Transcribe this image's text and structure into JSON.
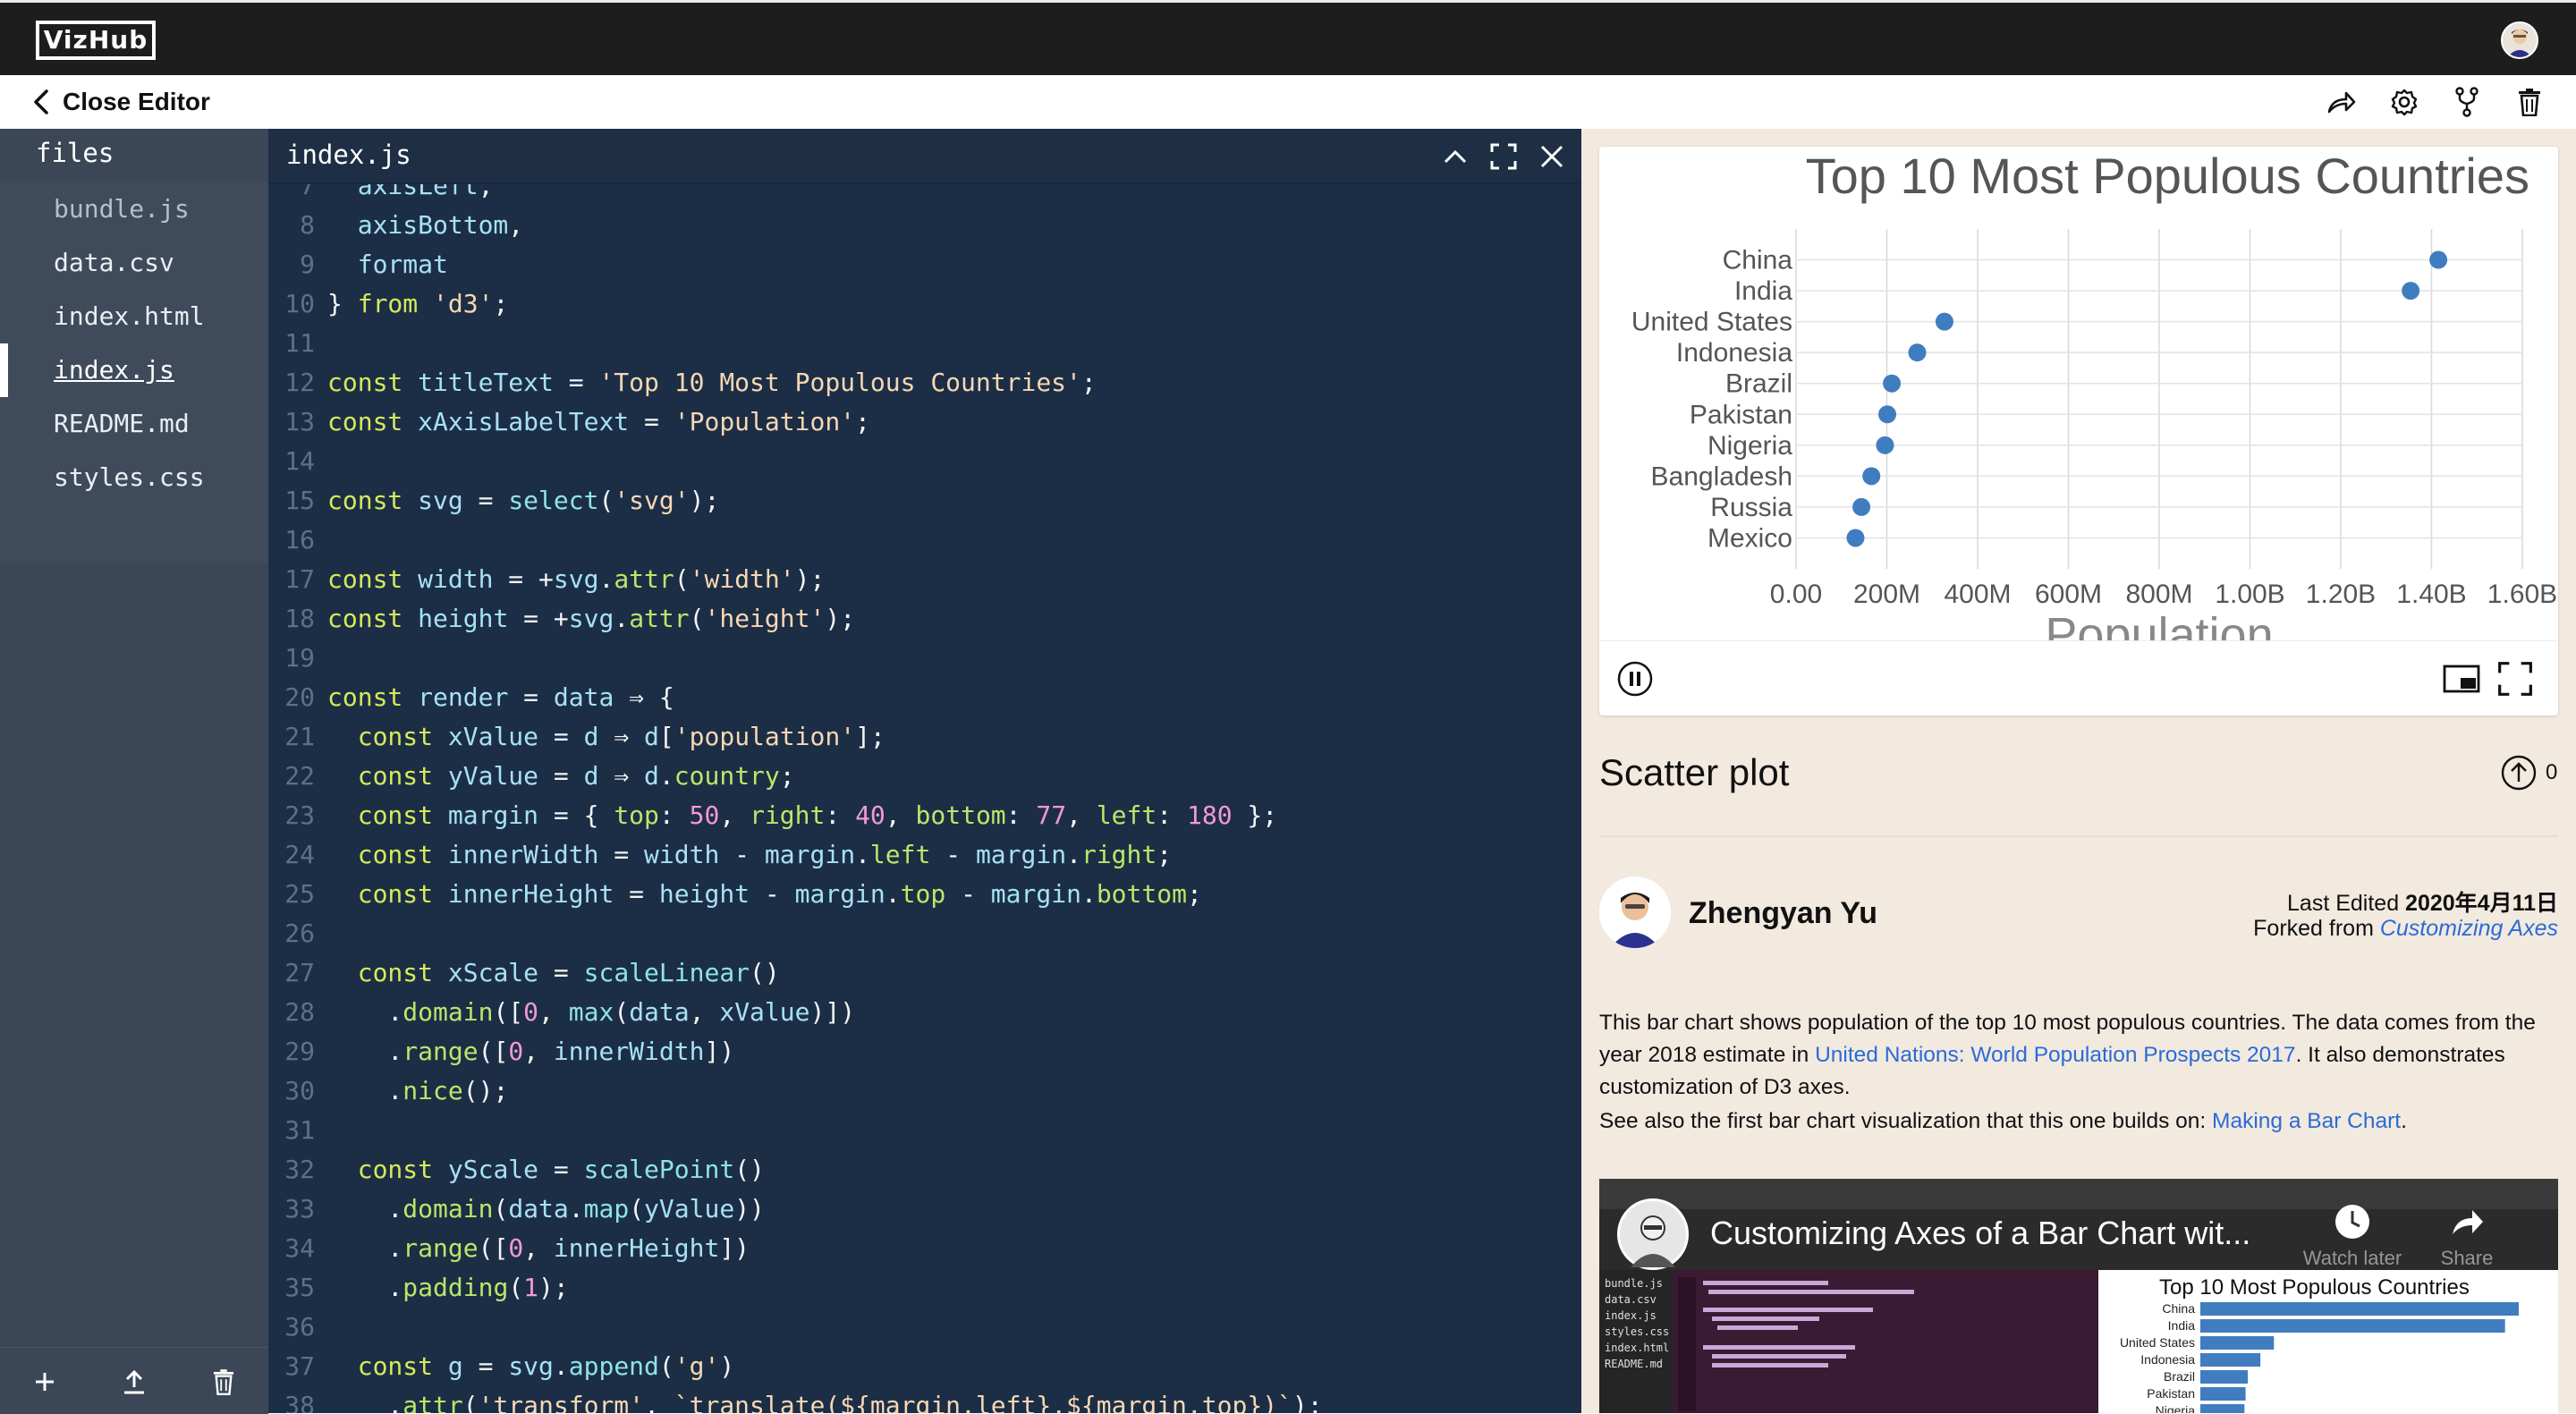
{
  "topbar": {
    "logo_text": "VizHub"
  },
  "header": {
    "close_label": "Close Editor"
  },
  "sidebar": {
    "title": "files",
    "files": [
      {
        "name": "bundle.js",
        "state": "muted"
      },
      {
        "name": "data.csv",
        "state": "normal"
      },
      {
        "name": "index.html",
        "state": "normal"
      },
      {
        "name": "index.js",
        "state": "active"
      },
      {
        "name": "README.md",
        "state": "normal"
      },
      {
        "name": "styles.css",
        "state": "normal"
      }
    ]
  },
  "editor": {
    "tab_name": "index.js",
    "lines": [
      {
        "n": "7",
        "t": [
          [
            "  ",
            "op"
          ],
          [
            "axisLeft",
            "id"
          ],
          [
            ",",
            "op"
          ]
        ]
      },
      {
        "n": "8",
        "t": [
          [
            "  ",
            "op"
          ],
          [
            "axisBottom",
            "id"
          ],
          [
            ",",
            "op"
          ]
        ]
      },
      {
        "n": "9",
        "t": [
          [
            "  ",
            "op"
          ],
          [
            "format",
            "id"
          ]
        ]
      },
      {
        "n": "10",
        "t": [
          [
            "} ",
            "op"
          ],
          [
            "from",
            "kw"
          ],
          [
            " ",
            "op"
          ],
          [
            "'d3'",
            "str"
          ],
          [
            ";",
            "op"
          ]
        ]
      },
      {
        "n": "11",
        "t": []
      },
      {
        "n": "12",
        "t": [
          [
            "const",
            "kw"
          ],
          [
            " ",
            "op"
          ],
          [
            "titleText",
            "id"
          ],
          [
            " = ",
            "op"
          ],
          [
            "'Top 10 Most Populous Countries'",
            "str"
          ],
          [
            ";",
            "op"
          ]
        ]
      },
      {
        "n": "13",
        "t": [
          [
            "const",
            "kw"
          ],
          [
            " ",
            "op"
          ],
          [
            "xAxisLabelText",
            "id"
          ],
          [
            " = ",
            "op"
          ],
          [
            "'Population'",
            "str"
          ],
          [
            ";",
            "op"
          ]
        ]
      },
      {
        "n": "14",
        "t": []
      },
      {
        "n": "15",
        "t": [
          [
            "const",
            "kw"
          ],
          [
            " ",
            "op"
          ],
          [
            "svg",
            "id"
          ],
          [
            " = ",
            "op"
          ],
          [
            "select",
            "fn"
          ],
          [
            "(",
            "op"
          ],
          [
            "'svg'",
            "str"
          ],
          [
            ");",
            "op"
          ]
        ]
      },
      {
        "n": "16",
        "t": []
      },
      {
        "n": "17",
        "t": [
          [
            "const",
            "kw"
          ],
          [
            " ",
            "op"
          ],
          [
            "width",
            "id"
          ],
          [
            " = +",
            "op"
          ],
          [
            "svg",
            "id"
          ],
          [
            ".",
            "op"
          ],
          [
            "attr",
            "prop"
          ],
          [
            "(",
            "op"
          ],
          [
            "'width'",
            "str"
          ],
          [
            ");",
            "op"
          ]
        ]
      },
      {
        "n": "18",
        "t": [
          [
            "const",
            "kw"
          ],
          [
            " ",
            "op"
          ],
          [
            "height",
            "id"
          ],
          [
            " = +",
            "op"
          ],
          [
            "svg",
            "id"
          ],
          [
            ".",
            "op"
          ],
          [
            "attr",
            "prop"
          ],
          [
            "(",
            "op"
          ],
          [
            "'height'",
            "str"
          ],
          [
            ");",
            "op"
          ]
        ]
      },
      {
        "n": "19",
        "t": []
      },
      {
        "n": "20",
        "t": [
          [
            "const",
            "kw"
          ],
          [
            " ",
            "op"
          ],
          [
            "render",
            "id"
          ],
          [
            " = ",
            "op"
          ],
          [
            "data",
            "id"
          ],
          [
            " ⇒ {",
            "op"
          ]
        ]
      },
      {
        "n": "21",
        "t": [
          [
            "  ",
            "op"
          ],
          [
            "const",
            "kw"
          ],
          [
            " ",
            "op"
          ],
          [
            "xValue",
            "id"
          ],
          [
            " = ",
            "op"
          ],
          [
            "d",
            "id"
          ],
          [
            " ⇒ ",
            "op"
          ],
          [
            "d",
            "id"
          ],
          [
            "[",
            "op"
          ],
          [
            "'population'",
            "str"
          ],
          [
            "];",
            "op"
          ]
        ]
      },
      {
        "n": "22",
        "t": [
          [
            "  ",
            "op"
          ],
          [
            "const",
            "kw"
          ],
          [
            " ",
            "op"
          ],
          [
            "yValue",
            "id"
          ],
          [
            " = ",
            "op"
          ],
          [
            "d",
            "id"
          ],
          [
            " ⇒ ",
            "op"
          ],
          [
            "d",
            "id"
          ],
          [
            ".",
            "op"
          ],
          [
            "country",
            "prop"
          ],
          [
            ";",
            "op"
          ]
        ]
      },
      {
        "n": "23",
        "t": [
          [
            "  ",
            "op"
          ],
          [
            "const",
            "kw"
          ],
          [
            " ",
            "op"
          ],
          [
            "margin",
            "id"
          ],
          [
            " = { ",
            "op"
          ],
          [
            "top",
            "prop"
          ],
          [
            ": ",
            "op"
          ],
          [
            "50",
            "num"
          ],
          [
            ", ",
            "op"
          ],
          [
            "right",
            "prop"
          ],
          [
            ": ",
            "op"
          ],
          [
            "40",
            "num"
          ],
          [
            ", ",
            "op"
          ],
          [
            "bottom",
            "prop"
          ],
          [
            ": ",
            "op"
          ],
          [
            "77",
            "num"
          ],
          [
            ", ",
            "op"
          ],
          [
            "left",
            "prop"
          ],
          [
            ": ",
            "op"
          ],
          [
            "180",
            "num"
          ],
          [
            " };",
            "op"
          ]
        ]
      },
      {
        "n": "24",
        "t": [
          [
            "  ",
            "op"
          ],
          [
            "const",
            "kw"
          ],
          [
            " ",
            "op"
          ],
          [
            "innerWidth",
            "id"
          ],
          [
            " = ",
            "op"
          ],
          [
            "width",
            "id"
          ],
          [
            " - ",
            "op"
          ],
          [
            "margin",
            "id"
          ],
          [
            ".",
            "op"
          ],
          [
            "left",
            "prop"
          ],
          [
            " - ",
            "op"
          ],
          [
            "margin",
            "id"
          ],
          [
            ".",
            "op"
          ],
          [
            "right",
            "prop"
          ],
          [
            ";",
            "op"
          ]
        ]
      },
      {
        "n": "25",
        "t": [
          [
            "  ",
            "op"
          ],
          [
            "const",
            "kw"
          ],
          [
            " ",
            "op"
          ],
          [
            "innerHeight",
            "id"
          ],
          [
            " = ",
            "op"
          ],
          [
            "height",
            "id"
          ],
          [
            " - ",
            "op"
          ],
          [
            "margin",
            "id"
          ],
          [
            ".",
            "op"
          ],
          [
            "top",
            "prop"
          ],
          [
            " - ",
            "op"
          ],
          [
            "margin",
            "id"
          ],
          [
            ".",
            "op"
          ],
          [
            "bottom",
            "prop"
          ],
          [
            ";",
            "op"
          ]
        ]
      },
      {
        "n": "26",
        "t": []
      },
      {
        "n": "27",
        "t": [
          [
            "  ",
            "op"
          ],
          [
            "const",
            "kw"
          ],
          [
            " ",
            "op"
          ],
          [
            "xScale",
            "id"
          ],
          [
            " = ",
            "op"
          ],
          [
            "scaleLinear",
            "fn"
          ],
          [
            "()",
            "op"
          ]
        ]
      },
      {
        "n": "28",
        "t": [
          [
            "    .",
            "op"
          ],
          [
            "domain",
            "prop"
          ],
          [
            "([",
            "op"
          ],
          [
            "0",
            "num"
          ],
          [
            ", ",
            "op"
          ],
          [
            "max",
            "fn"
          ],
          [
            "(",
            "op"
          ],
          [
            "data",
            "id"
          ],
          [
            ", ",
            "op"
          ],
          [
            "xValue",
            "id"
          ],
          [
            ")])",
            "op"
          ]
        ]
      },
      {
        "n": "29",
        "t": [
          [
            "    .",
            "op"
          ],
          [
            "range",
            "prop"
          ],
          [
            "([",
            "op"
          ],
          [
            "0",
            "num"
          ],
          [
            ", ",
            "op"
          ],
          [
            "innerWidth",
            "id"
          ],
          [
            "])",
            "op"
          ]
        ]
      },
      {
        "n": "30",
        "t": [
          [
            "    .",
            "op"
          ],
          [
            "nice",
            "prop"
          ],
          [
            "();",
            "op"
          ]
        ]
      },
      {
        "n": "31",
        "t": []
      },
      {
        "n": "32",
        "t": [
          [
            "  ",
            "op"
          ],
          [
            "const",
            "kw"
          ],
          [
            " ",
            "op"
          ],
          [
            "yScale",
            "id"
          ],
          [
            " = ",
            "op"
          ],
          [
            "scalePoint",
            "fn"
          ],
          [
            "()",
            "op"
          ]
        ]
      },
      {
        "n": "33",
        "t": [
          [
            "    .",
            "op"
          ],
          [
            "domain",
            "prop"
          ],
          [
            "(",
            "op"
          ],
          [
            "data",
            "id"
          ],
          [
            ".",
            "op"
          ],
          [
            "map",
            "fn"
          ],
          [
            "(",
            "op"
          ],
          [
            "yValue",
            "id"
          ],
          [
            "))",
            "op"
          ]
        ]
      },
      {
        "n": "34",
        "t": [
          [
            "    .",
            "op"
          ],
          [
            "range",
            "prop"
          ],
          [
            "([",
            "op"
          ],
          [
            "0",
            "num"
          ],
          [
            ", ",
            "op"
          ],
          [
            "innerHeight",
            "id"
          ],
          [
            "])",
            "op"
          ]
        ]
      },
      {
        "n": "35",
        "t": [
          [
            "    .",
            "op"
          ],
          [
            "padding",
            "prop"
          ],
          [
            "(",
            "op"
          ],
          [
            "1",
            "num"
          ],
          [
            ");",
            "op"
          ]
        ]
      },
      {
        "n": "36",
        "t": []
      },
      {
        "n": "37",
        "t": [
          [
            "  ",
            "op"
          ],
          [
            "const",
            "kw"
          ],
          [
            " ",
            "op"
          ],
          [
            "g",
            "id"
          ],
          [
            " = ",
            "op"
          ],
          [
            "svg",
            "id"
          ],
          [
            ".",
            "op"
          ],
          [
            "append",
            "fn"
          ],
          [
            "(",
            "op"
          ],
          [
            "'g'",
            "str"
          ],
          [
            ")",
            "op"
          ]
        ]
      },
      {
        "n": "38",
        "t": [
          [
            "    .",
            "op"
          ],
          [
            "attr",
            "prop"
          ],
          [
            "(",
            "op"
          ],
          [
            "'transform'",
            "str"
          ],
          [
            ", ",
            "op"
          ],
          [
            "`translate(${margin.left},${margin.top})`",
            "str"
          ],
          [
            ");",
            "op"
          ]
        ]
      }
    ]
  },
  "viz": {
    "title": "Scatter plot",
    "upvotes": "0",
    "author": "Zhengyan Yu",
    "last_edited_label": "Last Edited ",
    "last_edited_date": "2020年4月11日",
    "forked_label": "Forked from ",
    "forked_link": "Customizing Axes",
    "desc_part1": "This bar chart shows population of the top 10 most populous countries. The data comes from the year 2018 estimate in ",
    "desc_link": "United Nations: World Population Prospects 2017",
    "desc_part2": ". It also demonstrates customization of D3 axes.",
    "see_also_text": "See also the first bar chart visualization that this one builds on: ",
    "see_also_link": "Making a Bar Chart",
    "see_also_end": "."
  },
  "chart_data": {
    "type": "scatter",
    "title": "Top 10 Most Populous Countries",
    "xlabel": "Population",
    "ylabel": "",
    "categories": [
      "China",
      "India",
      "United States",
      "Indonesia",
      "Brazil",
      "Pakistan",
      "Nigeria",
      "Bangladesh",
      "Russia",
      "Mexico"
    ],
    "values": [
      1415000000,
      1354000000,
      327000000,
      267000000,
      211000000,
      201000000,
      196000000,
      166000000,
      144000000,
      131000000
    ],
    "xlim": [
      0,
      1600000000
    ],
    "xticks": [
      "0.00",
      "200M",
      "400M",
      "600M",
      "800M",
      "1.00B",
      "1.20B",
      "1.40B",
      "1.60B"
    ],
    "grid": true,
    "color": "#3f7dc0"
  },
  "video": {
    "title": "Customizing Axes of a Bar Chart wit...",
    "watch_later": "Watch later",
    "share": "Share",
    "chart_title": "Top 10 Most Populous Countries",
    "countries": [
      "China",
      "India",
      "United States",
      "Indonesia",
      "Brazil",
      "Pakistan",
      "Nigeria"
    ],
    "files": [
      "bundle.js",
      "data.csv",
      "index.js",
      "styles.css",
      "index.html",
      "README.md"
    ]
  },
  "colors": {
    "topbar": "#1d1d1d",
    "sidebar": "#3b4756",
    "editor": "#1c2e46",
    "panel": "#f2e9df",
    "dot": "#3f7dc0",
    "link": "#2a6bd6"
  }
}
